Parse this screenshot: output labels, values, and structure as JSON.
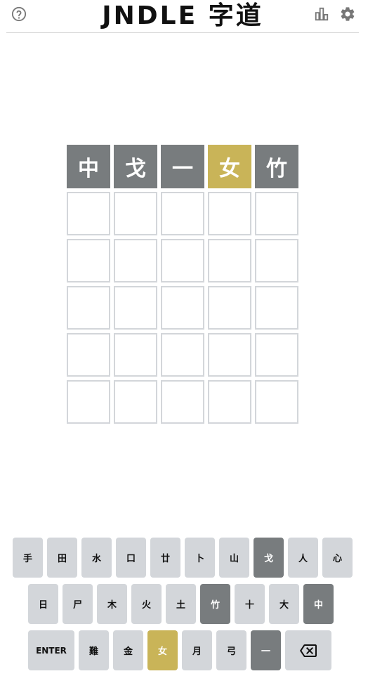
{
  "header": {
    "title": "JNDLE 字道",
    "help_icon": "help-circle-icon",
    "stats_icon": "bar-chart-icon",
    "settings_icon": "gear-icon"
  },
  "colors": {
    "absent": "#787c7e",
    "present": "#c9b458",
    "empty_border": "#d3d6da",
    "key_default": "#d3d6da"
  },
  "board": {
    "rows": [
      [
        {
          "char": "中",
          "state": "absent"
        },
        {
          "char": "戈",
          "state": "absent"
        },
        {
          "char": "一",
          "state": "absent"
        },
        {
          "char": "女",
          "state": "present"
        },
        {
          "char": "竹",
          "state": "absent"
        }
      ],
      [
        {
          "char": "",
          "state": "empty"
        },
        {
          "char": "",
          "state": "empty"
        },
        {
          "char": "",
          "state": "empty"
        },
        {
          "char": "",
          "state": "empty"
        },
        {
          "char": "",
          "state": "empty"
        }
      ],
      [
        {
          "char": "",
          "state": "empty"
        },
        {
          "char": "",
          "state": "empty"
        },
        {
          "char": "",
          "state": "empty"
        },
        {
          "char": "",
          "state": "empty"
        },
        {
          "char": "",
          "state": "empty"
        }
      ],
      [
        {
          "char": "",
          "state": "empty"
        },
        {
          "char": "",
          "state": "empty"
        },
        {
          "char": "",
          "state": "empty"
        },
        {
          "char": "",
          "state": "empty"
        },
        {
          "char": "",
          "state": "empty"
        }
      ],
      [
        {
          "char": "",
          "state": "empty"
        },
        {
          "char": "",
          "state": "empty"
        },
        {
          "char": "",
          "state": "empty"
        },
        {
          "char": "",
          "state": "empty"
        },
        {
          "char": "",
          "state": "empty"
        }
      ],
      [
        {
          "char": "",
          "state": "empty"
        },
        {
          "char": "",
          "state": "empty"
        },
        {
          "char": "",
          "state": "empty"
        },
        {
          "char": "",
          "state": "empty"
        },
        {
          "char": "",
          "state": "empty"
        }
      ]
    ]
  },
  "keyboard": {
    "rows": [
      [
        {
          "label": "手",
          "state": "default"
        },
        {
          "label": "田",
          "state": "default"
        },
        {
          "label": "水",
          "state": "default"
        },
        {
          "label": "口",
          "state": "default"
        },
        {
          "label": "廿",
          "state": "default"
        },
        {
          "label": "卜",
          "state": "default"
        },
        {
          "label": "山",
          "state": "default"
        },
        {
          "label": "戈",
          "state": "absent"
        },
        {
          "label": "人",
          "state": "default"
        },
        {
          "label": "心",
          "state": "default"
        }
      ],
      [
        {
          "label": "日",
          "state": "default"
        },
        {
          "label": "尸",
          "state": "default"
        },
        {
          "label": "木",
          "state": "default"
        },
        {
          "label": "火",
          "state": "default"
        },
        {
          "label": "土",
          "state": "default"
        },
        {
          "label": "竹",
          "state": "absent"
        },
        {
          "label": "十",
          "state": "default"
        },
        {
          "label": "大",
          "state": "default"
        },
        {
          "label": "中",
          "state": "absent"
        }
      ],
      [
        {
          "label": "ENTER",
          "state": "default",
          "kind": "enter"
        },
        {
          "label": "難",
          "state": "default"
        },
        {
          "label": "金",
          "state": "default"
        },
        {
          "label": "女",
          "state": "present"
        },
        {
          "label": "月",
          "state": "default"
        },
        {
          "label": "弓",
          "state": "default"
        },
        {
          "label": "一",
          "state": "absent"
        },
        {
          "label": "",
          "state": "default",
          "kind": "backspace",
          "icon": "backspace-icon"
        }
      ]
    ]
  }
}
